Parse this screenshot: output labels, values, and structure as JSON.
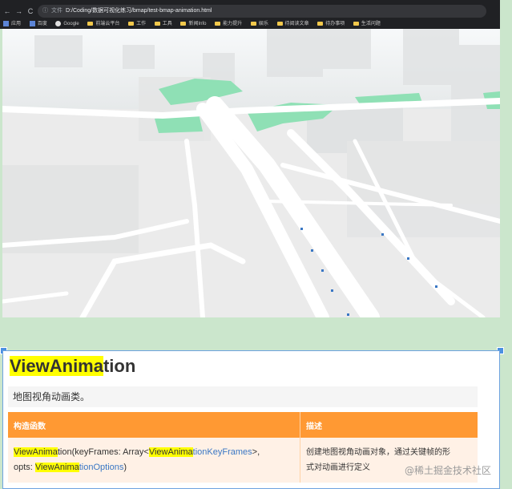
{
  "browser": {
    "back": "←",
    "forward": "→",
    "reload": "C",
    "info": "ⓘ",
    "url_label": "文件",
    "url": "D:/Coding/数据可视化练习/bmap/test-bmap-animation.html",
    "bookmarks": [
      {
        "label": "应用",
        "icon": "apps-icon"
      },
      {
        "label": "百度",
        "icon": "baidu-icon"
      },
      {
        "label": "Google",
        "icon": "google-icon"
      },
      {
        "label": "前端云平台",
        "icon": "folder-icon"
      },
      {
        "label": "工作",
        "icon": "folder-icon"
      },
      {
        "label": "工具",
        "icon": "folder-icon"
      },
      {
        "label": "新闻Info",
        "icon": "folder-icon"
      },
      {
        "label": "能力提升",
        "icon": "folder-icon"
      },
      {
        "label": "娱乐",
        "icon": "folder-icon"
      },
      {
        "label": "待阅读文章",
        "icon": "folder-icon"
      },
      {
        "label": "待办事项",
        "icon": "folder-icon"
      },
      {
        "label": "生活问题",
        "icon": "folder-icon"
      }
    ]
  },
  "doc": {
    "title_hl": "ViewAnima",
    "title_rest": "tion",
    "description": "地图视角动画类。",
    "table": {
      "headers": [
        "构造函数",
        "描述"
      ],
      "row": {
        "c1_hl1": "ViewAnima",
        "c1_t1": "tion(keyFrames: Array<",
        "c1_hl2": "ViewAnima",
        "c1_link1": "tionKeyFrames",
        "c1_t2": ">,",
        "c1_t3": "opts: ",
        "c1_hl3": "ViewAnima",
        "c1_link2": "tionOptions",
        "c1_t4": ")",
        "c2_line1": "创建地图视角动画对象，通过关键帧的形",
        "c2_line2": "式对动画进行定义"
      }
    }
  },
  "watermark": "@稀土掘金技术社区",
  "colors": {
    "highlight": "#ffff00",
    "header": "#ff9933",
    "link": "#3a77c4",
    "page_bg": "#cbe6cc"
  }
}
